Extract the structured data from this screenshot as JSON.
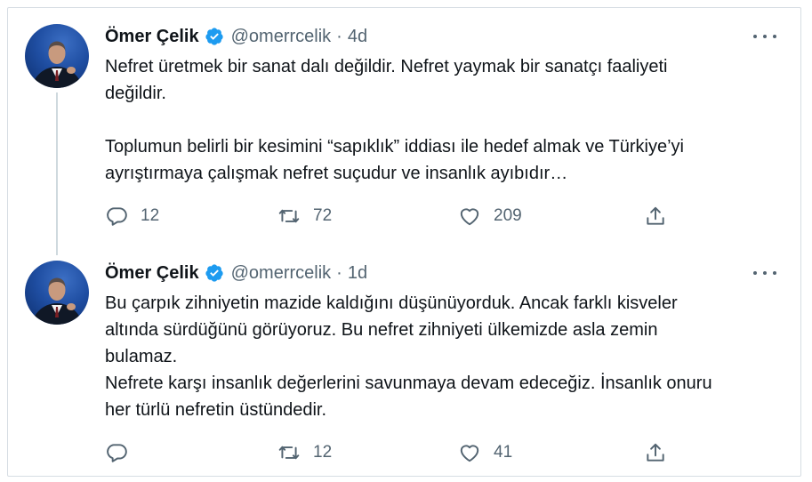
{
  "colors": {
    "text": "#0f1419",
    "secondary": "#536471",
    "verified": "#1d9bf0",
    "thread_line": "#cfd9de"
  },
  "tweets": [
    {
      "name": "Ömer Çelik",
      "handle": "@omerrcelik",
      "separator": "·",
      "time": "4d",
      "text": "Nefret üretmek bir sanat dalı değildir. Nefret yaymak bir sanatçı faaliyeti\ndeğildir.\n\nToplumun belirli bir kesimini “sapıklık” iddiası ile hedef almak ve Türkiye’yi\nayrıştırmaya çalışmak nefret suçudur ve insanlık ayıbıdır…",
      "replies": "12",
      "retweets": "72",
      "likes": "209",
      "icons": [
        "reply-icon",
        "retweet-icon",
        "like-icon",
        "share-icon",
        "more-icon",
        "verified-icon"
      ]
    },
    {
      "name": "Ömer Çelik",
      "handle": "@omerrcelik",
      "separator": "·",
      "time": "1d",
      "text": "Bu çarpık zihniyetin mazide kaldığını düşünüyorduk. Ancak farklı kisveler\naltında sürdüğünü görüyoruz. Bu nefret zihniyeti ülkemizde asla zemin\nbulamaz.\nNefrete karşı insanlık değerlerini savunmaya devam edeceğiz. İnsanlık onuru\nher türlü nefretin üstündedir.",
      "replies": "",
      "retweets": "12",
      "likes": "41",
      "icons": [
        "reply-icon",
        "retweet-icon",
        "like-icon",
        "share-icon",
        "more-icon",
        "verified-icon"
      ]
    }
  ]
}
